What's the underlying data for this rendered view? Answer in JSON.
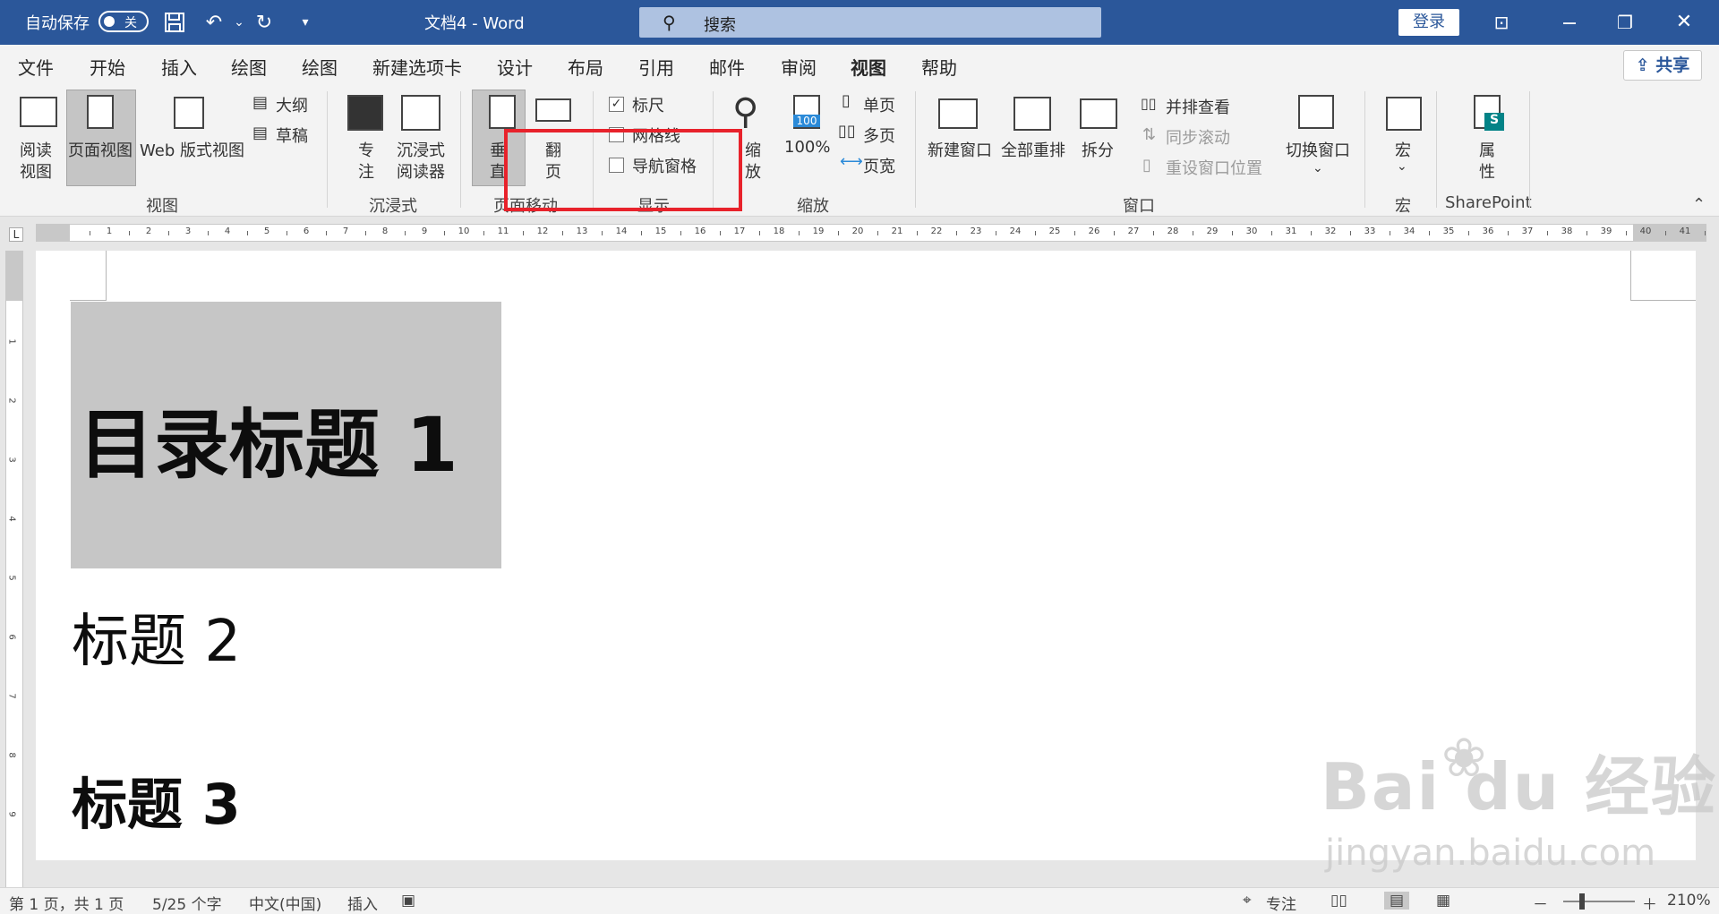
{
  "titlebar": {
    "autosave_label": "自动保存",
    "autosave_state": "关",
    "doc_title": "文档4  -  Word",
    "search_placeholder": "搜索",
    "login_label": "登录",
    "icons": [
      "save-icon",
      "undo-icon",
      "redo-icon",
      "customize-icon",
      "ribbon-display-icon",
      "restore-icon",
      "close-icon"
    ]
  },
  "tabs": {
    "items": [
      "文件",
      "开始",
      "插入",
      "绘图",
      "绘图",
      "新建选项卡",
      "设计",
      "布局",
      "引用",
      "邮件",
      "审阅",
      "视图",
      "帮助"
    ],
    "active": "视图",
    "share_label": "共享"
  },
  "ribbon": {
    "views": {
      "read": "阅读\n视图",
      "read_l1": "阅读",
      "read_l2": "视图",
      "print": "页面视图",
      "web": "Web 版式视图",
      "outline": "大纲",
      "draft": "草稿",
      "group": "视图"
    },
    "immersive": {
      "focus_l1": "专",
      "focus_l2": "注",
      "reader_l1": "沉浸式",
      "reader_l2": "阅读器",
      "group": "沉浸式"
    },
    "pagemove": {
      "vertical_l1": "垂",
      "vertical_l2": "直",
      "side_l1": "翻",
      "side_l2": "页",
      "group": "页面移动"
    },
    "show": {
      "ruler": "标尺",
      "ruler_checked": true,
      "gridlines": "网格线",
      "gridlines_checked": false,
      "navpane": "导航窗格",
      "navpane_checked": false,
      "group": "显示"
    },
    "zoom": {
      "zoom_l1": "缩",
      "zoom_l2": "放",
      "hundred": "100%",
      "hundred_icon_text": "100",
      "one_page": "单页",
      "multi_page": "多页",
      "page_width": "页宽",
      "group": "缩放"
    },
    "window": {
      "new_window": "新建窗口",
      "arrange_all": "全部重排",
      "split": "拆分",
      "side_by_side": "并排查看",
      "sync_scroll": "同步滚动",
      "reset_pos": "重设窗口位置",
      "switch": "切换窗口",
      "group": "窗口"
    },
    "macros": {
      "label": "宏",
      "group": "宏"
    },
    "sharepoint": {
      "props_l1": "属",
      "props_l2": "性",
      "group": "SharePoint"
    }
  },
  "ruler": {
    "numbers": [
      "1",
      "2",
      "3",
      "4",
      "5",
      "6",
      "7",
      "8",
      "9",
      "10",
      "11",
      "12",
      "13",
      "14",
      "15",
      "16",
      "17",
      "18",
      "19",
      "20",
      "21",
      "22",
      "23",
      "24",
      "25",
      "26",
      "27",
      "28",
      "29",
      "30",
      "31",
      "32",
      "33",
      "34",
      "35",
      "36",
      "37",
      "38",
      "39",
      "40",
      "41"
    ],
    "vnumbers": [
      "1",
      "2",
      "3",
      "4",
      "5",
      "6",
      "7",
      "8",
      "9"
    ],
    "tab_symbol": "L"
  },
  "document": {
    "heading1": "目录标题 1",
    "heading2": "标题 2",
    "heading3": "标题 3"
  },
  "watermark": {
    "brand": "Bai  du 经验",
    "url": "jingyan.baidu.com"
  },
  "status": {
    "page": "第 1 页，共 1 页",
    "words": "5/25 个字",
    "language": "中文(中国)",
    "mode": "插入",
    "focus": "专注",
    "zoom_minus": "－",
    "zoom_plus": "＋",
    "zoom": "210%"
  }
}
